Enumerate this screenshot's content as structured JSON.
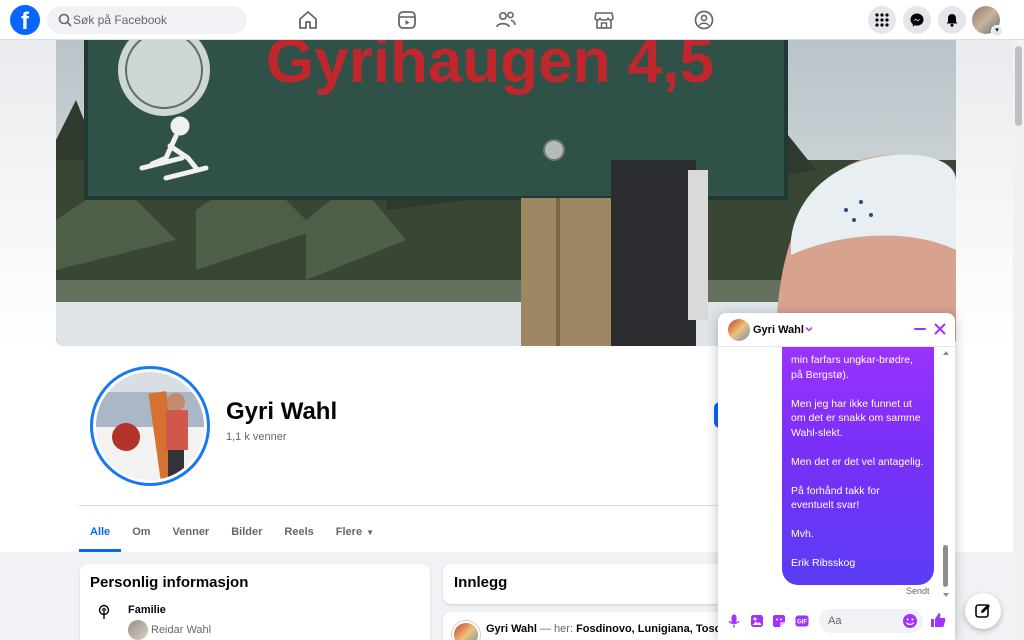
{
  "topbar": {
    "logo_letter": "f",
    "search_placeholder": "Søk på Facebook",
    "nav_icons": [
      "home-icon",
      "video-icon",
      "friends-icon",
      "marketplace-icon",
      "groups-icon"
    ],
    "right_icons": [
      "menu-grid-icon",
      "messenger-icon",
      "notifications-icon"
    ]
  },
  "profile": {
    "name": "Gyri Wahl",
    "friends": "1,1 k venner"
  },
  "tabs": [
    {
      "label": "Alle",
      "active": true
    },
    {
      "label": "Om"
    },
    {
      "label": "Venner"
    },
    {
      "label": "Bilder"
    },
    {
      "label": "Reels"
    },
    {
      "label": "Flere"
    }
  ],
  "info": {
    "title": "Personlig informasjon",
    "family_label": "Familie",
    "member_name": "Reidar Wahl"
  },
  "posts": {
    "title": "Innlegg",
    "first": {
      "author": "Gyri Wahl",
      "sep": " — her: ",
      "place": "Fosdinovo, Lunigiana, Toscana"
    }
  },
  "chat": {
    "name": "Gyri Wahl",
    "messages": [
      "min farfars ungkar-brødre, på Bergstø).",
      "Men jeg har ikke funnet ut om det er snakk om samme Wahl-slekt.",
      "Men det er det vel antagelig.",
      "På forhånd takk for eventuelt svar!",
      "Mvh.",
      "Erik Ribsskog"
    ],
    "sent_label": "Sendt",
    "input_placeholder": "Aa",
    "colors": {
      "bubble_top": "#a033ff",
      "bubble_bottom": "#5b3cf5",
      "accent": "#a033ff"
    }
  },
  "colors": {
    "brand": "#0866ff"
  }
}
